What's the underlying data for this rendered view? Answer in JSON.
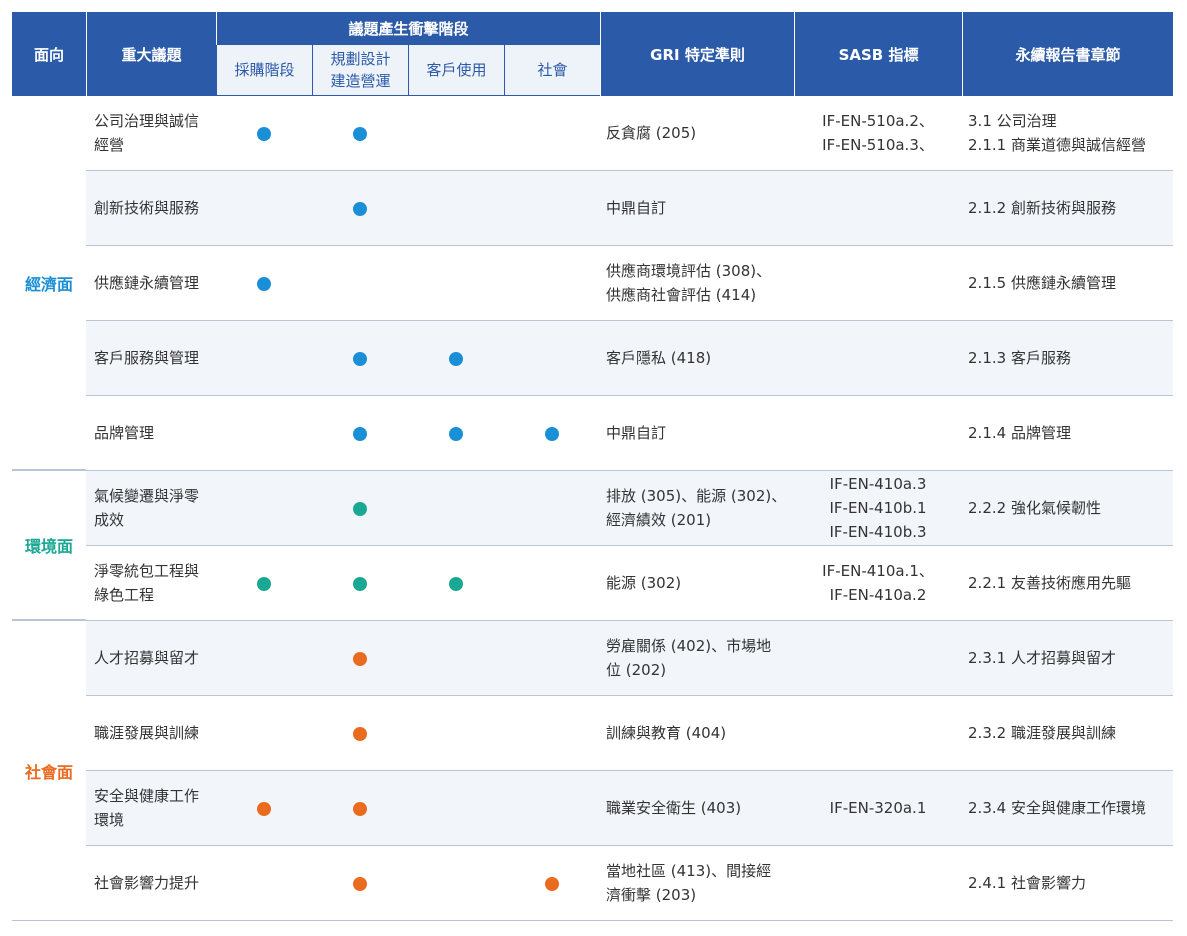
{
  "colors": {
    "header": "#2b5aa8",
    "econ": "#1a8fd6",
    "env": "#1aa894",
    "soc": "#ea6b20"
  },
  "header": {
    "aspect": "面向",
    "topic": "重大議題",
    "stage_group": "議題產生衝擊階段",
    "stages": [
      "採購階段",
      "規劃設計",
      "建造營運",
      "客戶使用",
      "社會"
    ],
    "gri": "GRI 特定準則",
    "sasb": "SASB 指標",
    "chapter": "永續報告書章節"
  },
  "aspects": {
    "econ": "經濟面",
    "env": "環境面",
    "soc": "社會面"
  },
  "rows": [
    {
      "topic": [
        "公司治理與誠信",
        "經營"
      ],
      "dots": [
        true,
        true,
        false,
        false
      ],
      "gri": [
        "反貪腐 (205)"
      ],
      "sasb": [
        "IF-EN-510a.2、",
        "IF-EN-510a.3、"
      ],
      "chapter": [
        "3.1 公司治理",
        "2.1.1 商業道德與誠信經營"
      ]
    },
    {
      "topic": [
        "創新技術與服務"
      ],
      "dots": [
        false,
        true,
        false,
        false
      ],
      "gri": [
        "中鼎自訂"
      ],
      "sasb": [],
      "chapter": [
        "2.1.2 創新技術與服務"
      ]
    },
    {
      "topic": [
        "供應鏈永續管理"
      ],
      "dots": [
        true,
        false,
        false,
        false
      ],
      "gri": [
        "供應商環境評估 (308)、",
        "供應商社會評估 (414)"
      ],
      "sasb": [],
      "chapter": [
        "2.1.5 供應鏈永續管理"
      ]
    },
    {
      "topic": [
        "客戶服務與管理"
      ],
      "dots": [
        false,
        true,
        true,
        false
      ],
      "gri": [
        "客戶隱私 (418)"
      ],
      "sasb": [],
      "chapter": [
        "2.1.3 客戶服務"
      ]
    },
    {
      "topic": [
        "品牌管理"
      ],
      "dots": [
        false,
        true,
        true,
        true
      ],
      "gri": [
        "中鼎自訂"
      ],
      "sasb": [],
      "chapter": [
        "2.1.4 品牌管理"
      ]
    },
    {
      "topic": [
        "氣候變遷與淨零",
        "成效"
      ],
      "dots": [
        false,
        true,
        false,
        false
      ],
      "gri": [
        "排放 (305)、能源 (302)、",
        "經濟績效 (201)"
      ],
      "sasb": [
        "IF-EN-410a.3",
        "IF-EN-410b.1",
        "IF-EN-410b.3"
      ],
      "chapter": [
        "2.2.2 強化氣候韌性"
      ]
    },
    {
      "topic": [
        "淨零統包工程與",
        "綠色工程"
      ],
      "dots": [
        true,
        true,
        true,
        false
      ],
      "gri": [
        "能源 (302)"
      ],
      "sasb": [
        "IF-EN-410a.1、",
        "IF-EN-410a.2"
      ],
      "chapter": [
        "2.2.1 友善技術應用先驅"
      ]
    },
    {
      "topic": [
        "人才招募與留才"
      ],
      "dots": [
        false,
        true,
        false,
        false
      ],
      "gri": [
        "勞雇關係 (402)、市場地",
        "位 (202)"
      ],
      "sasb": [],
      "chapter": [
        "2.3.1 人才招募與留才"
      ]
    },
    {
      "topic": [
        "職涯發展與訓練"
      ],
      "dots": [
        false,
        true,
        false,
        false
      ],
      "gri": [
        "訓練與教育 (404)"
      ],
      "sasb": [],
      "chapter": [
        "2.3.2 職涯發展與訓練"
      ]
    },
    {
      "topic": [
        "安全與健康工作",
        "環境"
      ],
      "dots": [
        true,
        true,
        false,
        false
      ],
      "gri": [
        "職業安全衛生 (403)"
      ],
      "sasb": [
        "IF-EN-320a.1"
      ],
      "chapter": [
        "2.3.4 安全與健康工作環境"
      ]
    },
    {
      "topic": [
        "社會影響力提升"
      ],
      "dots": [
        false,
        true,
        false,
        true
      ],
      "gri": [
        "當地社區 (413)、間接經",
        "濟衝擊 (203)"
      ],
      "sasb": [],
      "chapter": [
        "2.4.1 社會影響力"
      ]
    }
  ]
}
